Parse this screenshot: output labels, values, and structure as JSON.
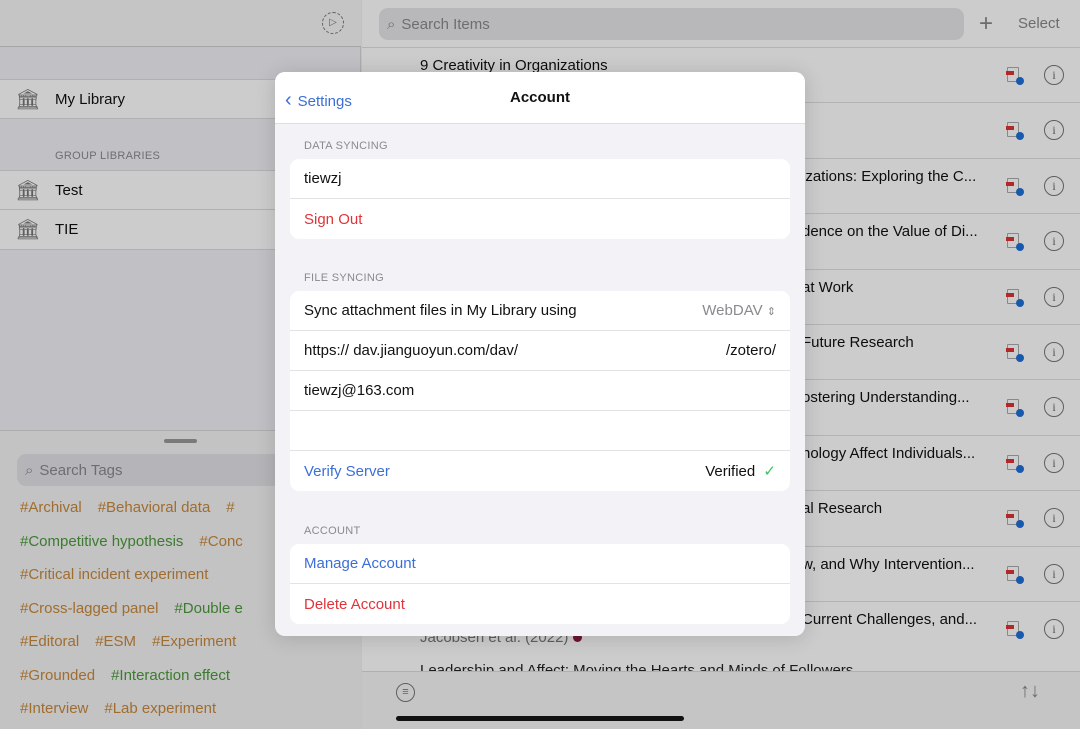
{
  "sidebar": {
    "my_library": "My Library",
    "group_header": "GROUP LIBRARIES",
    "groups": [
      "Test",
      "TIE"
    ],
    "settings_icon": "gear-icon"
  },
  "tags": {
    "search_placeholder": "Search Tags",
    "lines": [
      [
        {
          "t": "#Archival",
          "c": "#c8893c"
        },
        {
          "t": "#Behavioral data",
          "c": "#c8893c"
        },
        {
          "t": "#",
          "c": "#c8893c"
        }
      ],
      [
        {
          "t": "#Competitive hypothesis",
          "c": "#4c9a3c"
        },
        {
          "t": "#Conc",
          "c": "#c8893c"
        }
      ],
      [
        {
          "t": "#Critical incident experiment",
          "c": "#c8893c"
        }
      ],
      [
        {
          "t": "#Cross-lagged panel",
          "c": "#c8893c"
        },
        {
          "t": "#Double e",
          "c": "#4c9a3c"
        }
      ],
      [
        {
          "t": "#Editoral",
          "c": "#c8893c"
        },
        {
          "t": "#ESM",
          "c": "#c8893c"
        },
        {
          "t": "#Experiment",
          "c": "#c8893c"
        }
      ],
      [
        {
          "t": "#Grounded",
          "c": "#c8893c"
        },
        {
          "t": "#Interaction effect",
          "c": "#4c9a3c"
        }
      ],
      [
        {
          "t": "#Interview",
          "c": "#c8893c"
        },
        {
          "t": "#Lab experiment",
          "c": "#c8893c"
        }
      ]
    ]
  },
  "items": {
    "search_placeholder": "Search Items",
    "add_label": "+",
    "select_label": "Select",
    "rows": [
      "9 Creativity in Organizations",
      "",
      "izations: Exploring the C...",
      "dence on the Value of Di...",
      "at Work",
      "Future Research",
      "ostering Understanding...",
      "nology Affect Individuals...",
      "al Research",
      "w, and Why Intervention...",
      "Current Challenges, and..."
    ],
    "last_subtitle": "Jacobsen et al. (2022)",
    "next_title": "Leadership and Affect: Moving the Hearts and Minds of Followers"
  },
  "modal": {
    "back_label": "Settings",
    "title": "Account",
    "data_syncing": {
      "header": "DATA SYNCING",
      "username": "tiewzj",
      "sign_out": "Sign Out"
    },
    "file_syncing": {
      "header": "FILE SYNCING",
      "sync_label": "Sync attachment files in My Library using",
      "sync_value": "WebDAV",
      "url_prefix": "https://",
      "url": "dav.jianguoyun.com/dav/",
      "url_suffix": "/zotero/",
      "username": "tiewzj@163.com",
      "password": "",
      "verify": "Verify Server",
      "status": "Verified"
    },
    "account": {
      "header": "ACCOUNT",
      "manage": "Manage Account",
      "delete": "Delete Account"
    }
  },
  "colors": {
    "accent": "#3b6fd6",
    "destructive": "#e0343a",
    "success": "#34c759"
  }
}
